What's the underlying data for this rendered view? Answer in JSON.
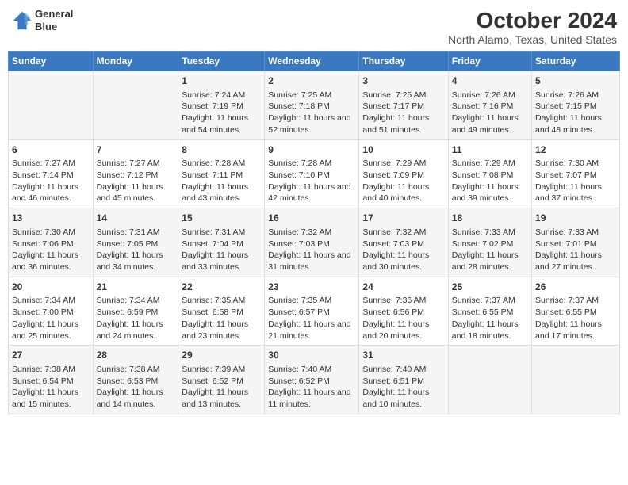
{
  "header": {
    "logo_line1": "General",
    "logo_line2": "Blue",
    "title": "October 2024",
    "subtitle": "North Alamo, Texas, United States"
  },
  "days_of_week": [
    "Sunday",
    "Monday",
    "Tuesday",
    "Wednesday",
    "Thursday",
    "Friday",
    "Saturday"
  ],
  "weeks": [
    [
      {
        "day": "",
        "info": ""
      },
      {
        "day": "",
        "info": ""
      },
      {
        "day": "1",
        "info": "Sunrise: 7:24 AM\nSunset: 7:19 PM\nDaylight: 11 hours and 54 minutes."
      },
      {
        "day": "2",
        "info": "Sunrise: 7:25 AM\nSunset: 7:18 PM\nDaylight: 11 hours and 52 minutes."
      },
      {
        "day": "3",
        "info": "Sunrise: 7:25 AM\nSunset: 7:17 PM\nDaylight: 11 hours and 51 minutes."
      },
      {
        "day": "4",
        "info": "Sunrise: 7:26 AM\nSunset: 7:16 PM\nDaylight: 11 hours and 49 minutes."
      },
      {
        "day": "5",
        "info": "Sunrise: 7:26 AM\nSunset: 7:15 PM\nDaylight: 11 hours and 48 minutes."
      }
    ],
    [
      {
        "day": "6",
        "info": "Sunrise: 7:27 AM\nSunset: 7:14 PM\nDaylight: 11 hours and 46 minutes."
      },
      {
        "day": "7",
        "info": "Sunrise: 7:27 AM\nSunset: 7:12 PM\nDaylight: 11 hours and 45 minutes."
      },
      {
        "day": "8",
        "info": "Sunrise: 7:28 AM\nSunset: 7:11 PM\nDaylight: 11 hours and 43 minutes."
      },
      {
        "day": "9",
        "info": "Sunrise: 7:28 AM\nSunset: 7:10 PM\nDaylight: 11 hours and 42 minutes."
      },
      {
        "day": "10",
        "info": "Sunrise: 7:29 AM\nSunset: 7:09 PM\nDaylight: 11 hours and 40 minutes."
      },
      {
        "day": "11",
        "info": "Sunrise: 7:29 AM\nSunset: 7:08 PM\nDaylight: 11 hours and 39 minutes."
      },
      {
        "day": "12",
        "info": "Sunrise: 7:30 AM\nSunset: 7:07 PM\nDaylight: 11 hours and 37 minutes."
      }
    ],
    [
      {
        "day": "13",
        "info": "Sunrise: 7:30 AM\nSunset: 7:06 PM\nDaylight: 11 hours and 36 minutes."
      },
      {
        "day": "14",
        "info": "Sunrise: 7:31 AM\nSunset: 7:05 PM\nDaylight: 11 hours and 34 minutes."
      },
      {
        "day": "15",
        "info": "Sunrise: 7:31 AM\nSunset: 7:04 PM\nDaylight: 11 hours and 33 minutes."
      },
      {
        "day": "16",
        "info": "Sunrise: 7:32 AM\nSunset: 7:03 PM\nDaylight: 11 hours and 31 minutes."
      },
      {
        "day": "17",
        "info": "Sunrise: 7:32 AM\nSunset: 7:03 PM\nDaylight: 11 hours and 30 minutes."
      },
      {
        "day": "18",
        "info": "Sunrise: 7:33 AM\nSunset: 7:02 PM\nDaylight: 11 hours and 28 minutes."
      },
      {
        "day": "19",
        "info": "Sunrise: 7:33 AM\nSunset: 7:01 PM\nDaylight: 11 hours and 27 minutes."
      }
    ],
    [
      {
        "day": "20",
        "info": "Sunrise: 7:34 AM\nSunset: 7:00 PM\nDaylight: 11 hours and 25 minutes."
      },
      {
        "day": "21",
        "info": "Sunrise: 7:34 AM\nSunset: 6:59 PM\nDaylight: 11 hours and 24 minutes."
      },
      {
        "day": "22",
        "info": "Sunrise: 7:35 AM\nSunset: 6:58 PM\nDaylight: 11 hours and 23 minutes."
      },
      {
        "day": "23",
        "info": "Sunrise: 7:35 AM\nSunset: 6:57 PM\nDaylight: 11 hours and 21 minutes."
      },
      {
        "day": "24",
        "info": "Sunrise: 7:36 AM\nSunset: 6:56 PM\nDaylight: 11 hours and 20 minutes."
      },
      {
        "day": "25",
        "info": "Sunrise: 7:37 AM\nSunset: 6:55 PM\nDaylight: 11 hours and 18 minutes."
      },
      {
        "day": "26",
        "info": "Sunrise: 7:37 AM\nSunset: 6:55 PM\nDaylight: 11 hours and 17 minutes."
      }
    ],
    [
      {
        "day": "27",
        "info": "Sunrise: 7:38 AM\nSunset: 6:54 PM\nDaylight: 11 hours and 15 minutes."
      },
      {
        "day": "28",
        "info": "Sunrise: 7:38 AM\nSunset: 6:53 PM\nDaylight: 11 hours and 14 minutes."
      },
      {
        "day": "29",
        "info": "Sunrise: 7:39 AM\nSunset: 6:52 PM\nDaylight: 11 hours and 13 minutes."
      },
      {
        "day": "30",
        "info": "Sunrise: 7:40 AM\nSunset: 6:52 PM\nDaylight: 11 hours and 11 minutes."
      },
      {
        "day": "31",
        "info": "Sunrise: 7:40 AM\nSunset: 6:51 PM\nDaylight: 11 hours and 10 minutes."
      },
      {
        "day": "",
        "info": ""
      },
      {
        "day": "",
        "info": ""
      }
    ]
  ]
}
